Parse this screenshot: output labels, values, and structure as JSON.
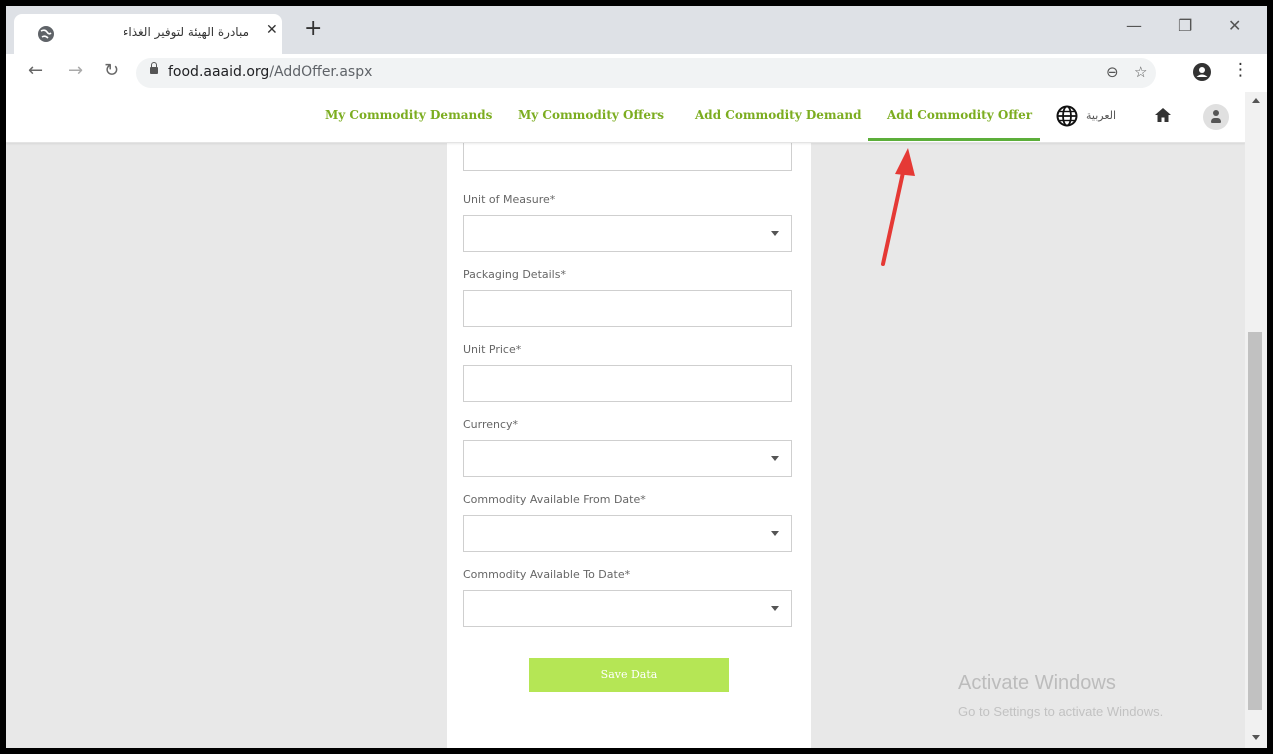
{
  "browser": {
    "tab_title": "مبادرة الهيئة لتوفير الغذاء",
    "tab_close": "✕",
    "new_tab": "+",
    "url_domain": "food.aaaid.org",
    "url_path": "/AddOffer.aspx",
    "icons": [
      "globe-icon",
      "back-icon",
      "forward-icon",
      "reload-icon",
      "lock-icon",
      "zoom-icon",
      "star-icon",
      "profile-icon",
      "menu-icon",
      "minimize-icon",
      "restore-icon",
      "close-icon"
    ]
  },
  "nav": {
    "items": [
      {
        "label": "My Commodity Demands"
      },
      {
        "label": "My Commodity Offers"
      },
      {
        "label": "Add Commodity Demand"
      },
      {
        "label": "Add Commodity Offer",
        "active": true
      }
    ],
    "language": "العربية",
    "active_color": "#7cad20"
  },
  "form": {
    "fields": [
      {
        "label": "Unit of Measure*",
        "type": "select",
        "value": ""
      },
      {
        "label": "Packaging Details*",
        "type": "text",
        "value": ""
      },
      {
        "label": "Unit Price*",
        "type": "text",
        "value": ""
      },
      {
        "label": "Currency*",
        "type": "select",
        "value": ""
      },
      {
        "label": "Commodity Available From Date*",
        "type": "select",
        "value": ""
      },
      {
        "label": "Commodity Available To Date*",
        "type": "select",
        "value": ""
      }
    ],
    "save_label": "Save Data",
    "save_color": "#b5e655"
  },
  "watermark": {
    "line1": "Activate Windows",
    "line2": "Go to Settings to activate Windows."
  },
  "annotation": {
    "arrow_color": "#e53935"
  }
}
